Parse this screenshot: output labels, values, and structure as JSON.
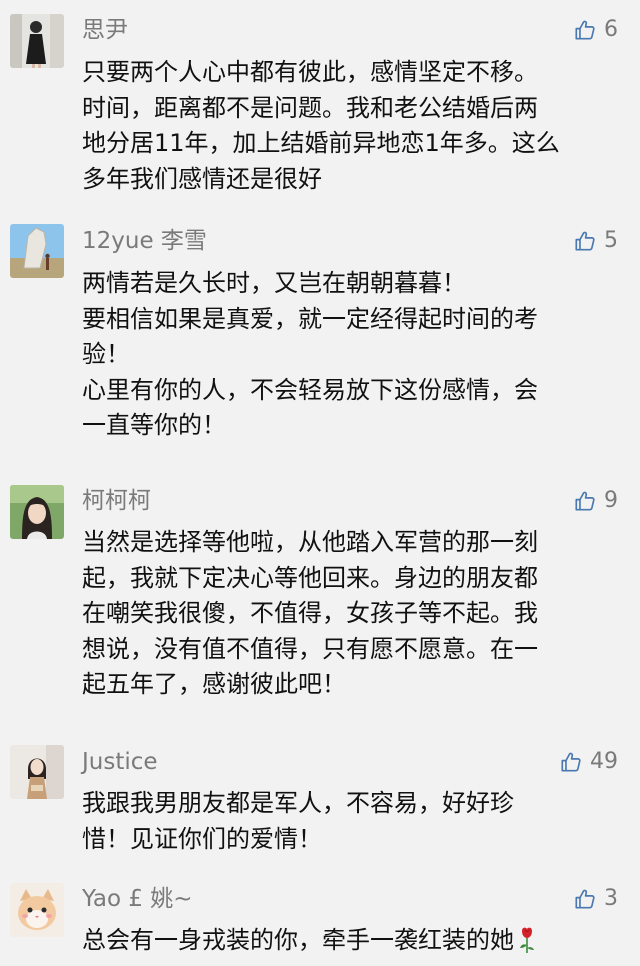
{
  "colors": {
    "background": "#f2f2f2",
    "username": "#7a7a7a",
    "like_icon": "#4a78b0",
    "content_text": "#111111"
  },
  "comments": [
    {
      "username": "思尹",
      "likes": "6",
      "avatar_icon": "avatar-girl-black-dress",
      "lines": [
        "只要两个人心中都有彼此，感情坚定不移。",
        "时间，距离都不是问题。我和老公结婚后两",
        "地分居11年，加上结婚前异地恋1年多。这么",
        "多年我们感情还是很好"
      ]
    },
    {
      "username": "12yue 李雪",
      "likes": "5",
      "avatar_icon": "avatar-rock-landscape",
      "lines": [
        "两情若是久长时，又岂在朝朝暮暮！",
        "要相信如果是真爱，就一定经得起时间的考",
        "验！",
        "心里有你的人，不会轻易放下这份感情，会",
        "一直等你的！"
      ]
    },
    {
      "username": "柯柯柯",
      "likes": "9",
      "avatar_icon": "avatar-girl-portrait",
      "lines": [
        "当然是选择等他啦，从他踏入军营的那一刻",
        "起，我就下定决心等他回来。身边的朋友都",
        "在嘲笑我很傻，不值得，女孩子等不起。我",
        "想说，没有值不值得，只有愿不愿意。在一",
        "起五年了，感谢彼此吧！"
      ]
    },
    {
      "username": "Justice",
      "likes": "49",
      "avatar_icon": "avatar-girl-standing",
      "lines": [
        "我跟我男朋友都是军人，不容易，好好珍",
        "惜！见证你们的爱情！"
      ]
    },
    {
      "username": "Yao £ 姚~",
      "likes": "3",
      "avatar_icon": "avatar-cat",
      "lines": [
        "总会有一身戎装的你，牵手一袭红装的她"
      ],
      "trailing_emoji": "rose-icon"
    }
  ]
}
